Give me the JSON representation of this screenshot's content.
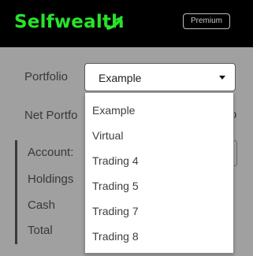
{
  "header": {
    "brand": "Selfwealth",
    "brand_color": "#28e32a",
    "premium_label": "Premium"
  },
  "form": {
    "portfolio_label": "Portfolio",
    "portfolio_selected": "Example",
    "net_portfolio_label": "Net Portfo",
    "net_portfolio_tail": "o"
  },
  "summary": {
    "account_label": "Account:",
    "holdings_label": "Holdings",
    "cash_label": "Cash",
    "total_label": "Total"
  },
  "dropdown": {
    "options": [
      "Example",
      "Virtual",
      "Trading 4",
      "Trading 5",
      "Trading 7",
      "Trading 8"
    ]
  },
  "icons": {
    "caret": "chevron-down-icon"
  }
}
